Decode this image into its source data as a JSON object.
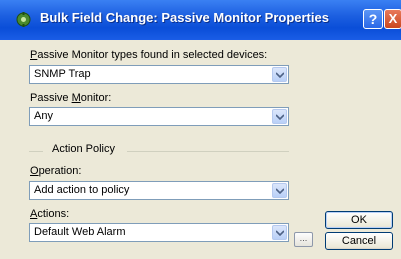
{
  "titlebar": {
    "title": "Bulk Field Change: Passive Monitor Properties",
    "help_label": "?",
    "close_label": "X"
  },
  "fields": {
    "monitor_types": {
      "label_hotkey": "P",
      "label_rest": "assive Monitor types found in selected devices:",
      "value": "SNMP Trap"
    },
    "passive_monitor": {
      "label_pre": "Passive ",
      "label_hotkey": "M",
      "label_rest": "onitor:",
      "value": "Any"
    }
  },
  "action_policy": {
    "group_label": "Action Policy",
    "operation": {
      "label_hotkey": "O",
      "label_rest": "peration:",
      "value": "Add action to policy"
    },
    "actions": {
      "label_hotkey": "A",
      "label_rest": "ctions:",
      "value": "Default Web Alarm",
      "ellipsis_label": "..."
    }
  },
  "buttons": {
    "ok": "OK",
    "cancel": "Cancel"
  },
  "colors": {
    "titlebar": "#0a4ed8",
    "dialog_bg": "#ece9d8",
    "combo_border": "#7f9db9"
  },
  "icons": {
    "title": "passive-monitor-gear-icon",
    "dropdown": "chevron-down-icon"
  }
}
